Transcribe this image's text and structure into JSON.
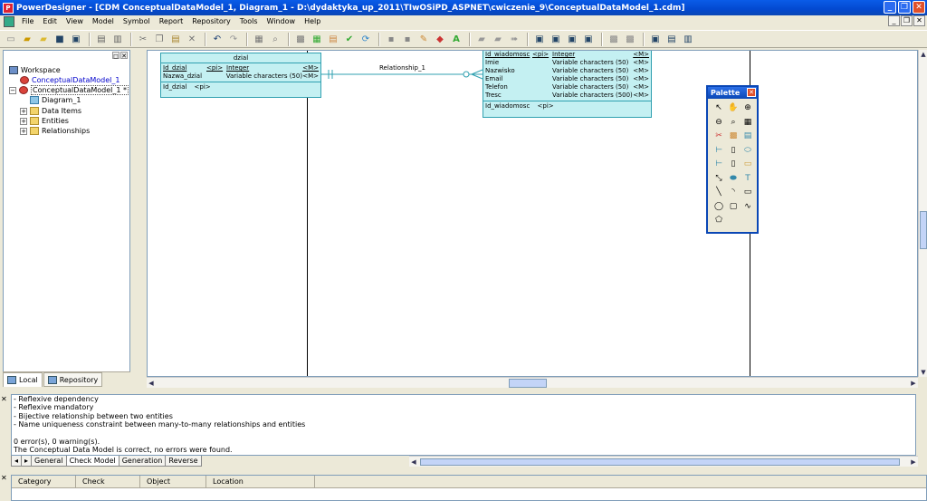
{
  "window": {
    "title": "PowerDesigner - [CDM ConceptualDataModel_1, Diagram_1 - D:\\dydaktyka_up_2011\\TIwOSiPD_ASPNET\\cwiczenie_9\\ConceptualDataModel_1.cdm]"
  },
  "menu": [
    "File",
    "Edit",
    "View",
    "Model",
    "Symbol",
    "Report",
    "Repository",
    "Tools",
    "Window",
    "Help"
  ],
  "browser": {
    "workspace": "Workspace",
    "model_closed": "ConceptualDataModel_1",
    "model_open": "ConceptualDataModel_1 *",
    "diagram": "Diagram_1",
    "data_items": "Data Items",
    "entities": "Entities",
    "relationships": "Relationships",
    "tab_local": "Local",
    "tab_repository": "Repository"
  },
  "diagram": {
    "entity1": {
      "name": "dzial",
      "attrs": [
        {
          "name": "Id_dzial",
          "pi": "<pi>",
          "type": "Integer",
          "mand": "<M>"
        },
        {
          "name": "Nazwa_dzial",
          "pi": "",
          "type": "Variable characters (50)",
          "mand": "<M>"
        }
      ],
      "identifier": {
        "name": "Id_dzial",
        "pi": "<pi>"
      }
    },
    "relationship": "Relationship_1",
    "entity2": {
      "attrs": [
        {
          "name": "Id_wiadomosc",
          "pi": "<pi>",
          "type": "Integer",
          "mand": "<M>"
        },
        {
          "name": "Imie",
          "pi": "",
          "type": "Variable characters (50)",
          "mand": "<M>"
        },
        {
          "name": "Nazwisko",
          "pi": "",
          "type": "Variable characters (50)",
          "mand": "<M>"
        },
        {
          "name": "Email",
          "pi": "",
          "type": "Variable characters (50)",
          "mand": "<M>"
        },
        {
          "name": "Telefon",
          "pi": "",
          "type": "Variable characters (50)",
          "mand": "<M>"
        },
        {
          "name": "Tresc",
          "pi": "",
          "type": "Variable characters (500)",
          "mand": "<M>"
        }
      ],
      "identifier": {
        "name": "Id_wiadomosc",
        "pi": "<pi>"
      }
    }
  },
  "palette": {
    "title": "Palette"
  },
  "output": {
    "lines": [
      "-   Reflexive dependency",
      "-   Reflexive mandatory",
      "-   Bijective relationship between two entities",
      "-   Name uniqueness constraint between many-to-many relationships and entities",
      "",
      "0 error(s),  0 warning(s).",
      "The Conceptual Data Model is correct, no errors were found."
    ],
    "tabs": [
      "General",
      "Check Model",
      "Generation",
      "Reverse"
    ]
  },
  "result_list": {
    "columns": [
      "Category",
      "Check",
      "Object",
      "Location"
    ]
  }
}
